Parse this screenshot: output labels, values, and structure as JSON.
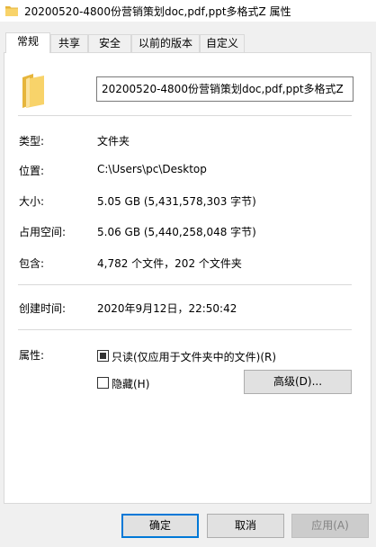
{
  "window": {
    "title": "20200520-4800份营销策划doc,pdf,ppt多格式Z 属性",
    "title_icon": "folder-icon"
  },
  "tabs": [
    {
      "label": "常规",
      "active": true
    },
    {
      "label": "共享",
      "active": false
    },
    {
      "label": "安全",
      "active": false
    },
    {
      "label": "以前的版本",
      "active": false
    },
    {
      "label": "自定义",
      "active": false
    }
  ],
  "general": {
    "folder_icon": "folder-icon",
    "name_value": "20200520-4800份营销策划doc,pdf,ppt多格式Z",
    "type_label": "类型:",
    "type_value": "文件夹",
    "location_label": "位置:",
    "location_value": "C:\\Users\\pc\\Desktop",
    "size_label": "大小:",
    "size_value": "5.05 GB (5,431,578,303 字节)",
    "disk_size_label": "占用空间:",
    "disk_size_value": "5.06 GB (5,440,258,048 字节)",
    "contains_label": "包含:",
    "contains_value": "4,782 个文件，202 个文件夹",
    "created_label": "创建时间:",
    "created_value": "2020年9月12日，22:50:42",
    "attributes_label": "属性:",
    "readonly_label": "只读(仅应用于文件夹中的文件)(R)",
    "readonly_state": "indeterminate",
    "hidden_label": "隐藏(H)",
    "hidden_checked": false,
    "advanced_button": "高级(D)..."
  },
  "footer": {
    "ok": "确定",
    "cancel": "取消",
    "apply": "应用(A)"
  },
  "colors": {
    "folder_yellow": "#f8d36a",
    "accent": "#0078d7"
  }
}
